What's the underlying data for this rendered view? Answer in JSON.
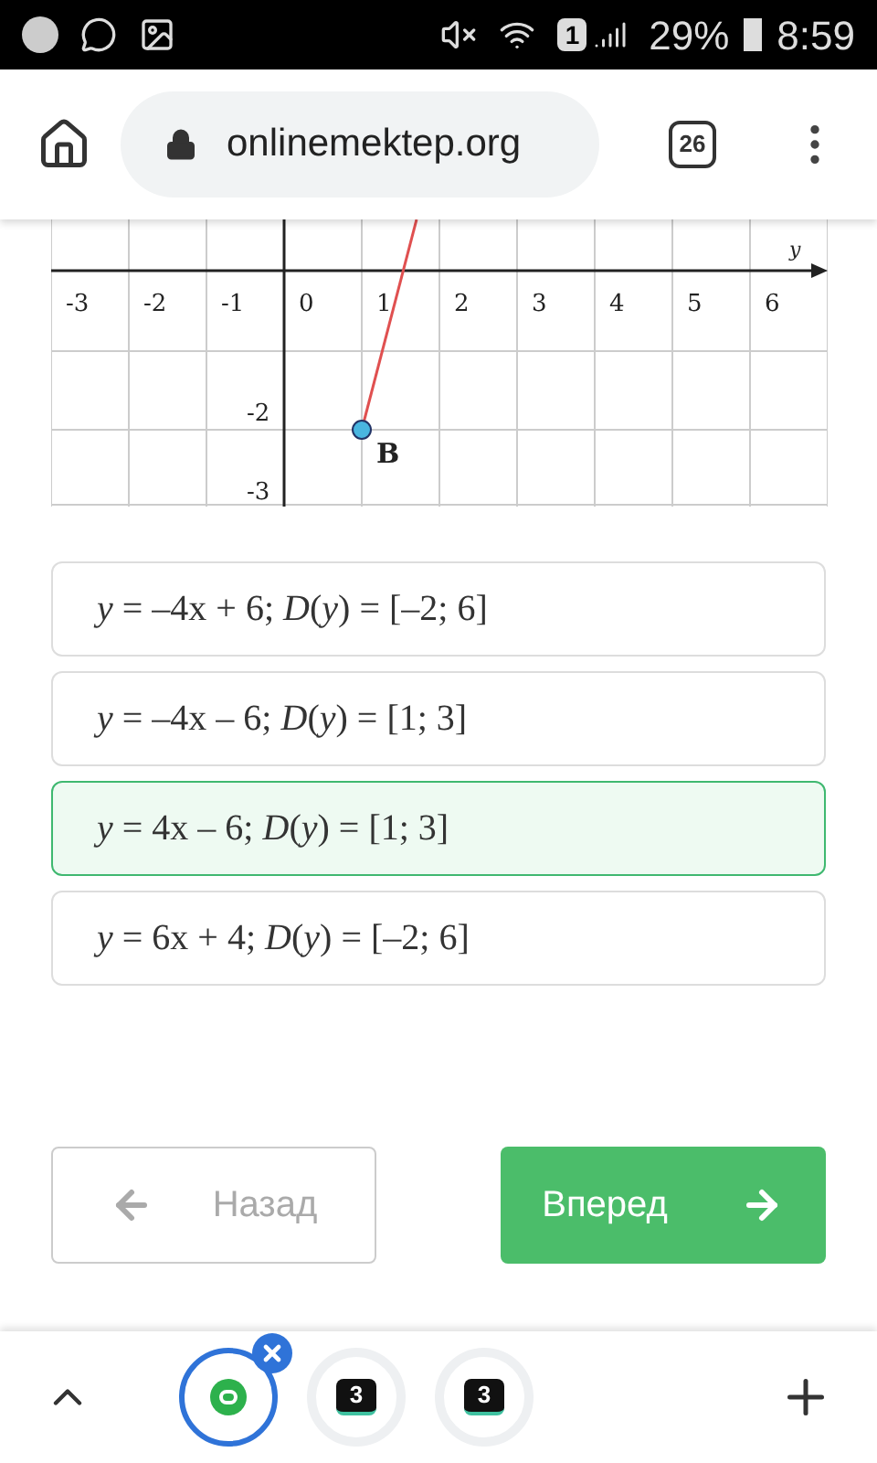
{
  "status_bar": {
    "battery": "29%",
    "time": "8:59",
    "sim": "1"
  },
  "browser": {
    "url": "onlinemektep.org",
    "tab_count": "26"
  },
  "graph": {
    "x_ticks": [
      "-3",
      "-2",
      "-1",
      "0",
      "1",
      "2",
      "3",
      "4",
      "5",
      "6"
    ],
    "y_ticks": [
      "-2",
      "-3"
    ],
    "axis_label": "y",
    "point_label": "B"
  },
  "options": [
    {
      "text": "*y* = –4x + 6; *D*(*y*) = [–2; 6]",
      "selected": false
    },
    {
      "text": "*y* = –4x – 6; *D*(*y*) = [1; 3]",
      "selected": false
    },
    {
      "text": "*y* = 4x – 6; *D*(*y*) = [1; 3]",
      "selected": true
    },
    {
      "text": "*y* = 6x + 4; *D*(*y*) = [–2; 6]",
      "selected": false
    }
  ],
  "nav": {
    "back": "Назад",
    "next": "Вперед"
  },
  "tab_switcher": {
    "tabs": [
      {
        "kind": "logo",
        "selected": true
      },
      {
        "kind": "digit",
        "label": "3",
        "selected": false
      },
      {
        "kind": "digit",
        "label": "3",
        "selected": false
      }
    ]
  }
}
